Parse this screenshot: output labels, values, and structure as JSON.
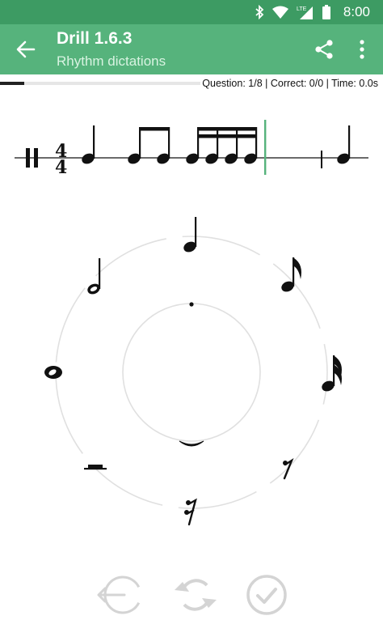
{
  "status": {
    "time": "8:00",
    "network": "LTE"
  },
  "appbar": {
    "title": "Drill 1.6.3",
    "subtitle": "Rhythm dictations"
  },
  "progress": {
    "fraction": 0.12
  },
  "stats": "Question: 1/8 | Correct: 0/0 | Time: 0.0s",
  "staff": {
    "time_signature_top": "4",
    "time_signature_bottom": "4"
  },
  "wheel": {
    "outer": [
      "quarter-note",
      "eighth-note",
      "sixteenth-note",
      "eighth-rest",
      "sixteenth-rest",
      "half-rest",
      "whole-note",
      "half-note"
    ],
    "inner": [
      "dot",
      "tie"
    ]
  },
  "colors": {
    "status_bar": "#3d9b63",
    "app_bar": "#56b37c",
    "cursor": "#56b37c"
  }
}
